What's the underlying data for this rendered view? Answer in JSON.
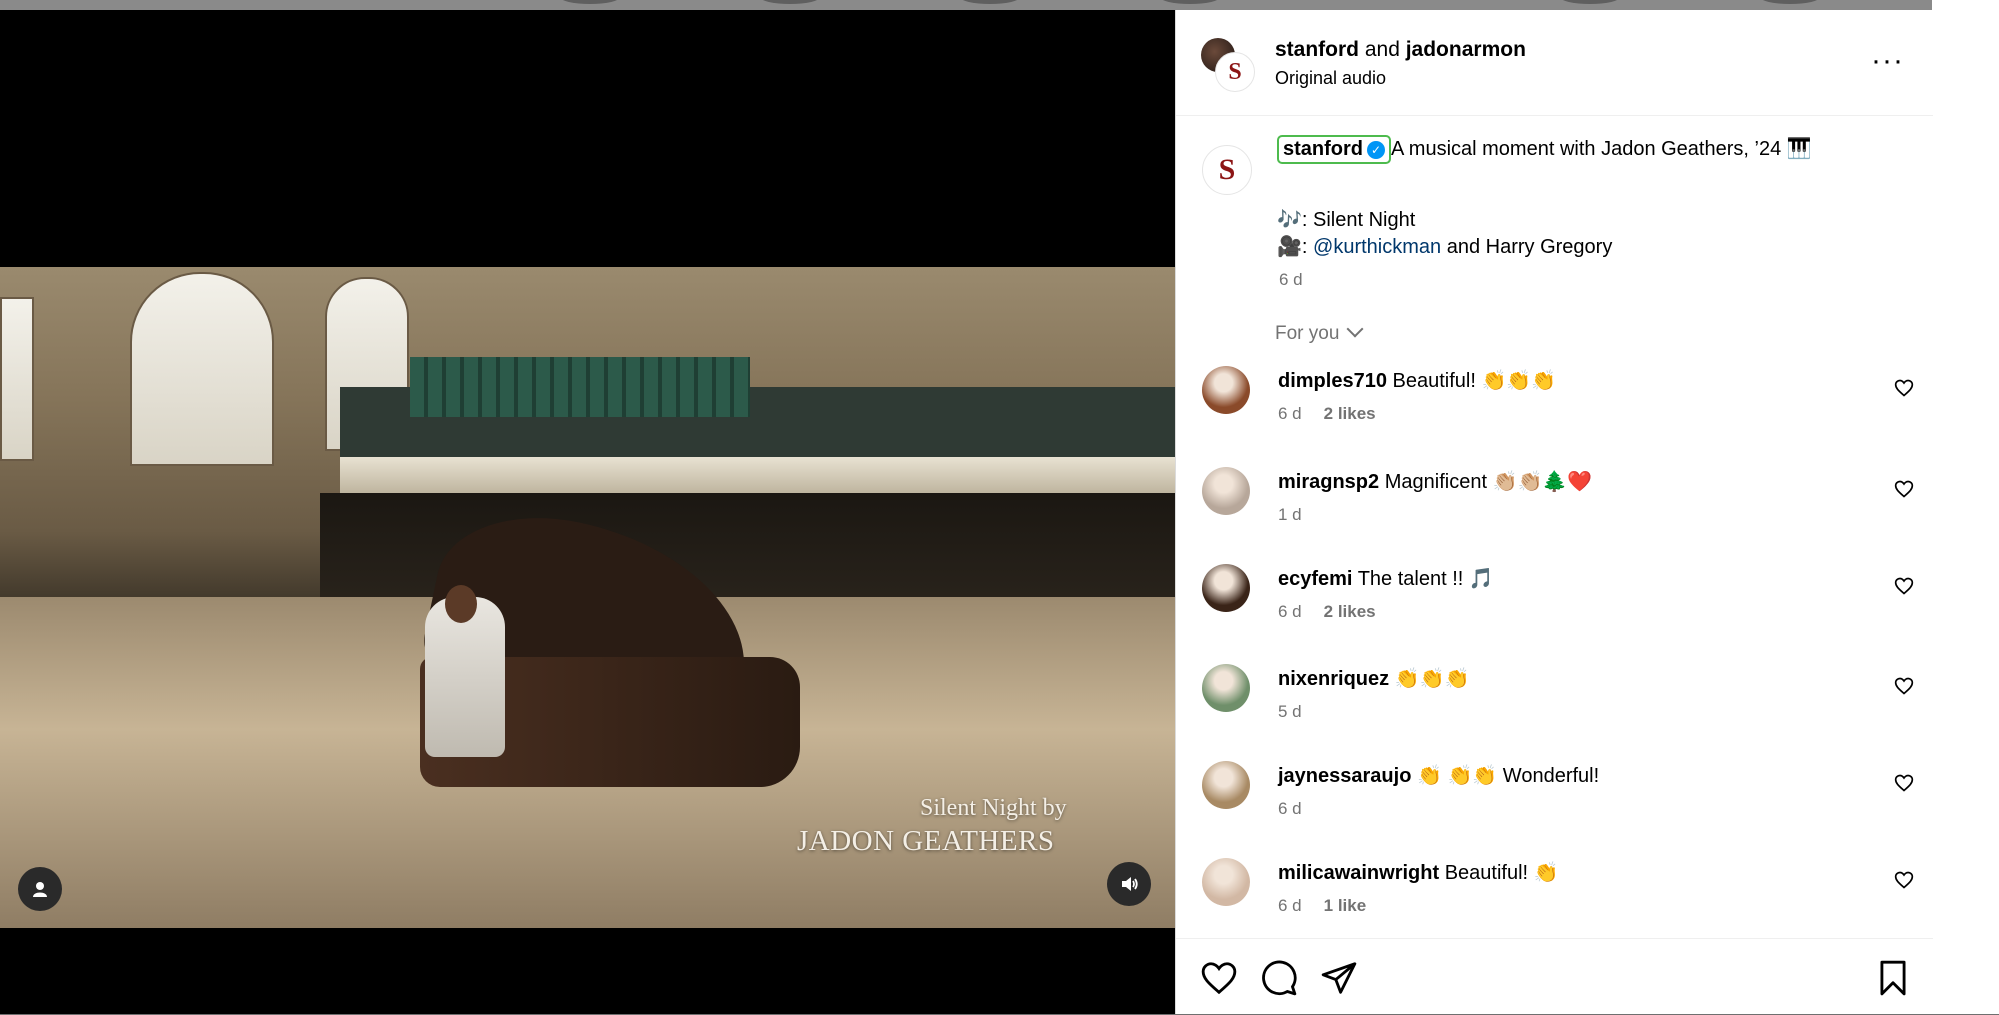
{
  "post": {
    "authors": "stanford and jadonarmon",
    "authors_primary": "stanford",
    "authors_joiner": " and ",
    "authors_secondary": "jadonarmon",
    "audio": "Original audio"
  },
  "video": {
    "overlay_line1": "Silent Night by",
    "overlay_line2": "JADON GEATHERS"
  },
  "caption": {
    "username": "stanford",
    "text": "A musical moment with Jadon Geathers, ’24 🎹",
    "song_line": "🎶: Silent Night",
    "credit_prefix": "🎥: ",
    "credit_mention": "@kurthickman",
    "credit_suffix": " and Harry Gregory",
    "time": "6 d"
  },
  "filter": {
    "label": "For you"
  },
  "comments": [
    {
      "user": "dimples710",
      "text": "Beautiful! 👏👏👏",
      "time": "6 d",
      "likes": "2 likes",
      "avatar_color": "#8a4a2a"
    },
    {
      "user": "miragnsp2",
      "text": "Magnificent 👏🏼👏🏼🌲❤️",
      "time": "1 d",
      "likes": "",
      "avatar_color": "#b7a79a"
    },
    {
      "user": "ecyfemi",
      "text": "The talent !! 🎵",
      "time": "6 d",
      "likes": "2 likes",
      "avatar_color": "#3a2418"
    },
    {
      "user": "nixenriquez",
      "text": "👏👏👏",
      "time": "5 d",
      "likes": "",
      "avatar_color": "#6f8f6a"
    },
    {
      "user": "jaynessaraujo",
      "text": "👏 👏👏 Wonderful!",
      "time": "6 d",
      "likes": "",
      "avatar_color": "#a88a64"
    },
    {
      "user": "milicawainwright",
      "text": "Beautiful! 👏",
      "time": "6 d",
      "likes": "1 like",
      "avatar_color": "#d2b8a4"
    }
  ],
  "icons": {
    "more": "more-options-icon",
    "like": "heart-icon",
    "comment": "comment-icon",
    "share": "share-icon",
    "save": "bookmark-icon",
    "profile": "user-icon",
    "audio": "speaker-icon"
  },
  "colors": {
    "verified": "#0095f6",
    "mention": "#00376b",
    "brand": "#8c1515"
  }
}
